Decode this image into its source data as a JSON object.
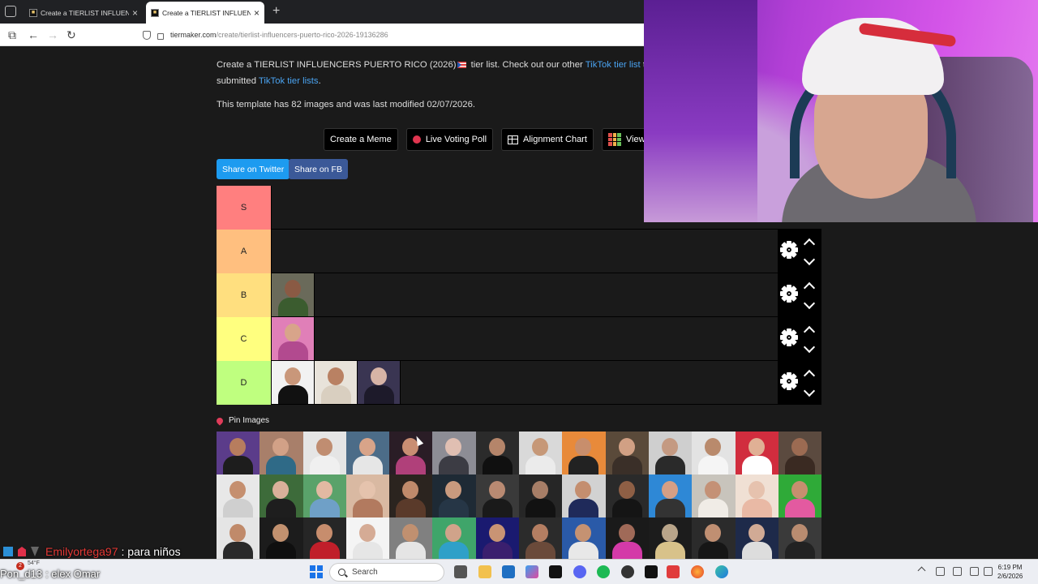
{
  "browser": {
    "tabs": [
      {
        "title": "Create a TIERLIST INFLUENCERS",
        "active": false
      },
      {
        "title": "Create a TIERLIST INFLUENCERS",
        "active": true
      }
    ],
    "url_domain": "tiermaker.com",
    "url_path": "/create/tierlist-influencers-puerto-rico-2026-19136286"
  },
  "page": {
    "intro_prefix": "Create a TIERLIST INFLUENCERS PUERTO RICO (2026)",
    "intro_mid": " tier list. Check out our other ",
    "intro_link1": "TikTok tier list",
    "intro_cont": " t",
    "intro_line2_prefix": "submitted ",
    "intro_link2": "TikTok tier lists",
    "intro_line2_suffix": ".",
    "modified": "This template has 82 images and was last modified 02/07/2026.",
    "tools": {
      "meme": "Create a Meme",
      "poll": "Live Voting Poll",
      "alignment": "Alignment Chart",
      "view": "View"
    },
    "share": {
      "twitter": "Share on Twitter",
      "facebook": "Share on FB"
    },
    "tiers": [
      {
        "label": "S",
        "color": "#ff7f7f",
        "items": []
      },
      {
        "label": "A",
        "color": "#ffbf7f",
        "items": []
      },
      {
        "label": "B",
        "color": "#ffdf7f",
        "items": [
          {
            "skin": "#8a5a44",
            "bg": "#6a6a5a",
            "cloth": "#3b5c2f"
          }
        ]
      },
      {
        "label": "C",
        "color": "#ffff7f",
        "items": [
          {
            "skin": "#d8a48a",
            "bg": "#e07fb8",
            "cloth": "#b24a8f"
          }
        ]
      },
      {
        "label": "D",
        "color": "#bfff7f",
        "items": [
          {
            "skin": "#c9977a",
            "bg": "#f2f2f2",
            "cloth": "#111111"
          },
          {
            "skin": "#b98163",
            "bg": "#e8e3da",
            "cloth": "#d9cfc0"
          },
          {
            "skin": "#d7b4a6",
            "bg": "#3a3552",
            "cloth": "#1d1a2a"
          }
        ]
      }
    ],
    "pin_label": "Pin Images",
    "pool": [
      {
        "skin": "#b77d5e",
        "bg": "#5b3c8a",
        "cloth": "#1d1d1d"
      },
      {
        "skin": "#d2a187",
        "bg": "#a87f6a",
        "cloth": "#2f6a87"
      },
      {
        "skin": "#c08d71",
        "bg": "#e5e5e5",
        "cloth": "#f0f0f0"
      },
      {
        "skin": "#d8a489",
        "bg": "#4c6c88",
        "cloth": "#e6e6e6"
      },
      {
        "skin": "#c98e73",
        "bg": "#2a1d26",
        "cloth": "#b0407a"
      },
      {
        "skin": "#e0bfb2",
        "bg": "#8d8d95",
        "cloth": "#3c3c44"
      },
      {
        "skin": "#b5856a",
        "bg": "#2b2b2b",
        "cloth": "#101010"
      },
      {
        "skin": "#c69878",
        "bg": "#d9d9d9",
        "cloth": "#ebebeb"
      },
      {
        "skin": "#c88e6c",
        "bg": "#e88a3a",
        "cloth": "#222222"
      },
      {
        "skin": "#d1a084",
        "bg": "#5a4a3a",
        "cloth": "#3a2f28"
      },
      {
        "skin": "#c49a82",
        "bg": "#cfcfcf",
        "cloth": "#2a2a2a"
      },
      {
        "skin": "#b98a6c",
        "bg": "#e3e3e3",
        "cloth": "#f5f5f5"
      },
      {
        "skin": "#e0b095",
        "bg": "#d12d3e",
        "cloth": "#ffffff"
      },
      {
        "skin": "#9c6b52",
        "bg": "#5b4a3f",
        "cloth": "#3a2a22"
      },
      {
        "skin": "#c58f6f",
        "bg": "#e8e8e8",
        "cloth": "#cfcfcf"
      },
      {
        "skin": "#d9b09a",
        "bg": "#3d6b3a",
        "cloth": "#1e1e1e"
      },
      {
        "skin": "#e2b9a2",
        "bg": "#5aa26a",
        "cloth": "#6fa0c7"
      },
      {
        "skin": "#e5c3ad",
        "bg": "#d9b9a2",
        "cloth": "#b27a5f"
      },
      {
        "skin": "#bf8a6b",
        "bg": "#2b241f",
        "cloth": "#5a3a2a"
      },
      {
        "skin": "#c99a7e",
        "bg": "#1e2a35",
        "cloth": "#263646"
      },
      {
        "skin": "#b98a72",
        "bg": "#3a3a3a",
        "cloth": "#1a1a1a"
      },
      {
        "skin": "#a77e67",
        "bg": "#262626",
        "cloth": "#121212"
      },
      {
        "skin": "#c48e6f",
        "bg": "#d2d2d2",
        "cloth": "#1f2a5a"
      },
      {
        "skin": "#8e5f45",
        "bg": "#2a2a2a",
        "cloth": "#151515"
      },
      {
        "skin": "#d59f85",
        "bg": "#2e88d6",
        "cloth": "#333333"
      },
      {
        "skin": "#c49176",
        "bg": "#c8c4bc",
        "cloth": "#f0ece6"
      },
      {
        "skin": "#e6c2ae",
        "bg": "#f0e0d4",
        "cloth": "#e9b9a5"
      },
      {
        "skin": "#c78f6f",
        "bg": "#2faa38",
        "cloth": "#e35aa0"
      },
      {
        "skin": "#c08a6a",
        "bg": "#e5e5e5",
        "cloth": "#2a2a2a"
      },
      {
        "skin": "#c2916f",
        "bg": "#1c1c1c",
        "cloth": "#0f0f0f"
      },
      {
        "skin": "#c78d6d",
        "bg": "#262626",
        "cloth": "#c01f2a"
      },
      {
        "skin": "#d5ab95",
        "bg": "#f4f4f4",
        "cloth": "#e6e6e6"
      },
      {
        "skin": "#c09070",
        "bg": "#808080",
        "cloth": "#e5e5e5"
      },
      {
        "skin": "#d0a38a",
        "bg": "#3fa56a",
        "cloth": "#2fa0c8"
      },
      {
        "skin": "#c99474",
        "bg": "#1a1a70",
        "cloth": "#3a1f6e"
      },
      {
        "skin": "#b47e62",
        "bg": "#2b2b2b",
        "cloth": "#6a4a3a"
      },
      {
        "skin": "#c59272",
        "bg": "#2a5aa8",
        "cloth": "#e8e8e8"
      },
      {
        "skin": "#a06a58",
        "bg": "#1a1a1a",
        "cloth": "#d43aa8"
      },
      {
        "skin": "#b9a58a",
        "bg": "#1c1c1c",
        "cloth": "#d8c28a"
      },
      {
        "skin": "#c08f72",
        "bg": "#2b2b2b",
        "cloth": "#161616"
      },
      {
        "skin": "#d1aa95",
        "bg": "#1e2a4a",
        "cloth": "#dddddd"
      },
      {
        "skin": "#b98c70",
        "bg": "#3a3a3a",
        "cloth": "#222222"
      }
    ],
    "cursor_visible": true
  },
  "overlay": {
    "chat_line1_user": "Emilyortega97",
    "chat_line1_msg": ": para niños",
    "chat_line2_user": "Pon_d13",
    "chat_line2_msg": ": elex Omar"
  },
  "taskbar": {
    "weather_temp": "54°F",
    "badge": "2",
    "search_label": "Search",
    "time": "6:19 PM",
    "date": "2/6/2026"
  }
}
